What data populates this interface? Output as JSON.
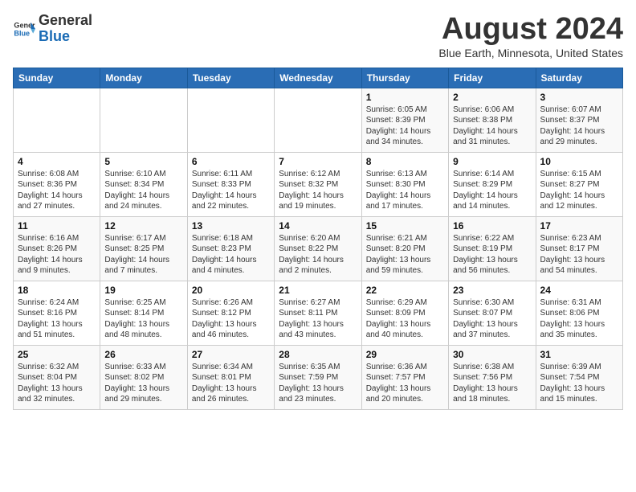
{
  "header": {
    "logo_general": "General",
    "logo_blue": "Blue",
    "month_year": "August 2024",
    "location": "Blue Earth, Minnesota, United States"
  },
  "days_of_week": [
    "Sunday",
    "Monday",
    "Tuesday",
    "Wednesday",
    "Thursday",
    "Friday",
    "Saturday"
  ],
  "weeks": [
    [
      {
        "day": "",
        "info": ""
      },
      {
        "day": "",
        "info": ""
      },
      {
        "day": "",
        "info": ""
      },
      {
        "day": "",
        "info": ""
      },
      {
        "day": "1",
        "info": "Sunrise: 6:05 AM\nSunset: 8:39 PM\nDaylight: 14 hours\nand 34 minutes."
      },
      {
        "day": "2",
        "info": "Sunrise: 6:06 AM\nSunset: 8:38 PM\nDaylight: 14 hours\nand 31 minutes."
      },
      {
        "day": "3",
        "info": "Sunrise: 6:07 AM\nSunset: 8:37 PM\nDaylight: 14 hours\nand 29 minutes."
      }
    ],
    [
      {
        "day": "4",
        "info": "Sunrise: 6:08 AM\nSunset: 8:36 PM\nDaylight: 14 hours\nand 27 minutes."
      },
      {
        "day": "5",
        "info": "Sunrise: 6:10 AM\nSunset: 8:34 PM\nDaylight: 14 hours\nand 24 minutes."
      },
      {
        "day": "6",
        "info": "Sunrise: 6:11 AM\nSunset: 8:33 PM\nDaylight: 14 hours\nand 22 minutes."
      },
      {
        "day": "7",
        "info": "Sunrise: 6:12 AM\nSunset: 8:32 PM\nDaylight: 14 hours\nand 19 minutes."
      },
      {
        "day": "8",
        "info": "Sunrise: 6:13 AM\nSunset: 8:30 PM\nDaylight: 14 hours\nand 17 minutes."
      },
      {
        "day": "9",
        "info": "Sunrise: 6:14 AM\nSunset: 8:29 PM\nDaylight: 14 hours\nand 14 minutes."
      },
      {
        "day": "10",
        "info": "Sunrise: 6:15 AM\nSunset: 8:27 PM\nDaylight: 14 hours\nand 12 minutes."
      }
    ],
    [
      {
        "day": "11",
        "info": "Sunrise: 6:16 AM\nSunset: 8:26 PM\nDaylight: 14 hours\nand 9 minutes."
      },
      {
        "day": "12",
        "info": "Sunrise: 6:17 AM\nSunset: 8:25 PM\nDaylight: 14 hours\nand 7 minutes."
      },
      {
        "day": "13",
        "info": "Sunrise: 6:18 AM\nSunset: 8:23 PM\nDaylight: 14 hours\nand 4 minutes."
      },
      {
        "day": "14",
        "info": "Sunrise: 6:20 AM\nSunset: 8:22 PM\nDaylight: 14 hours\nand 2 minutes."
      },
      {
        "day": "15",
        "info": "Sunrise: 6:21 AM\nSunset: 8:20 PM\nDaylight: 13 hours\nand 59 minutes."
      },
      {
        "day": "16",
        "info": "Sunrise: 6:22 AM\nSunset: 8:19 PM\nDaylight: 13 hours\nand 56 minutes."
      },
      {
        "day": "17",
        "info": "Sunrise: 6:23 AM\nSunset: 8:17 PM\nDaylight: 13 hours\nand 54 minutes."
      }
    ],
    [
      {
        "day": "18",
        "info": "Sunrise: 6:24 AM\nSunset: 8:16 PM\nDaylight: 13 hours\nand 51 minutes."
      },
      {
        "day": "19",
        "info": "Sunrise: 6:25 AM\nSunset: 8:14 PM\nDaylight: 13 hours\nand 48 minutes."
      },
      {
        "day": "20",
        "info": "Sunrise: 6:26 AM\nSunset: 8:12 PM\nDaylight: 13 hours\nand 46 minutes."
      },
      {
        "day": "21",
        "info": "Sunrise: 6:27 AM\nSunset: 8:11 PM\nDaylight: 13 hours\nand 43 minutes."
      },
      {
        "day": "22",
        "info": "Sunrise: 6:29 AM\nSunset: 8:09 PM\nDaylight: 13 hours\nand 40 minutes."
      },
      {
        "day": "23",
        "info": "Sunrise: 6:30 AM\nSunset: 8:07 PM\nDaylight: 13 hours\nand 37 minutes."
      },
      {
        "day": "24",
        "info": "Sunrise: 6:31 AM\nSunset: 8:06 PM\nDaylight: 13 hours\nand 35 minutes."
      }
    ],
    [
      {
        "day": "25",
        "info": "Sunrise: 6:32 AM\nSunset: 8:04 PM\nDaylight: 13 hours\nand 32 minutes."
      },
      {
        "day": "26",
        "info": "Sunrise: 6:33 AM\nSunset: 8:02 PM\nDaylight: 13 hours\nand 29 minutes."
      },
      {
        "day": "27",
        "info": "Sunrise: 6:34 AM\nSunset: 8:01 PM\nDaylight: 13 hours\nand 26 minutes."
      },
      {
        "day": "28",
        "info": "Sunrise: 6:35 AM\nSunset: 7:59 PM\nDaylight: 13 hours\nand 23 minutes."
      },
      {
        "day": "29",
        "info": "Sunrise: 6:36 AM\nSunset: 7:57 PM\nDaylight: 13 hours\nand 20 minutes."
      },
      {
        "day": "30",
        "info": "Sunrise: 6:38 AM\nSunset: 7:56 PM\nDaylight: 13 hours\nand 18 minutes."
      },
      {
        "day": "31",
        "info": "Sunrise: 6:39 AM\nSunset: 7:54 PM\nDaylight: 13 hours\nand 15 minutes."
      }
    ]
  ]
}
